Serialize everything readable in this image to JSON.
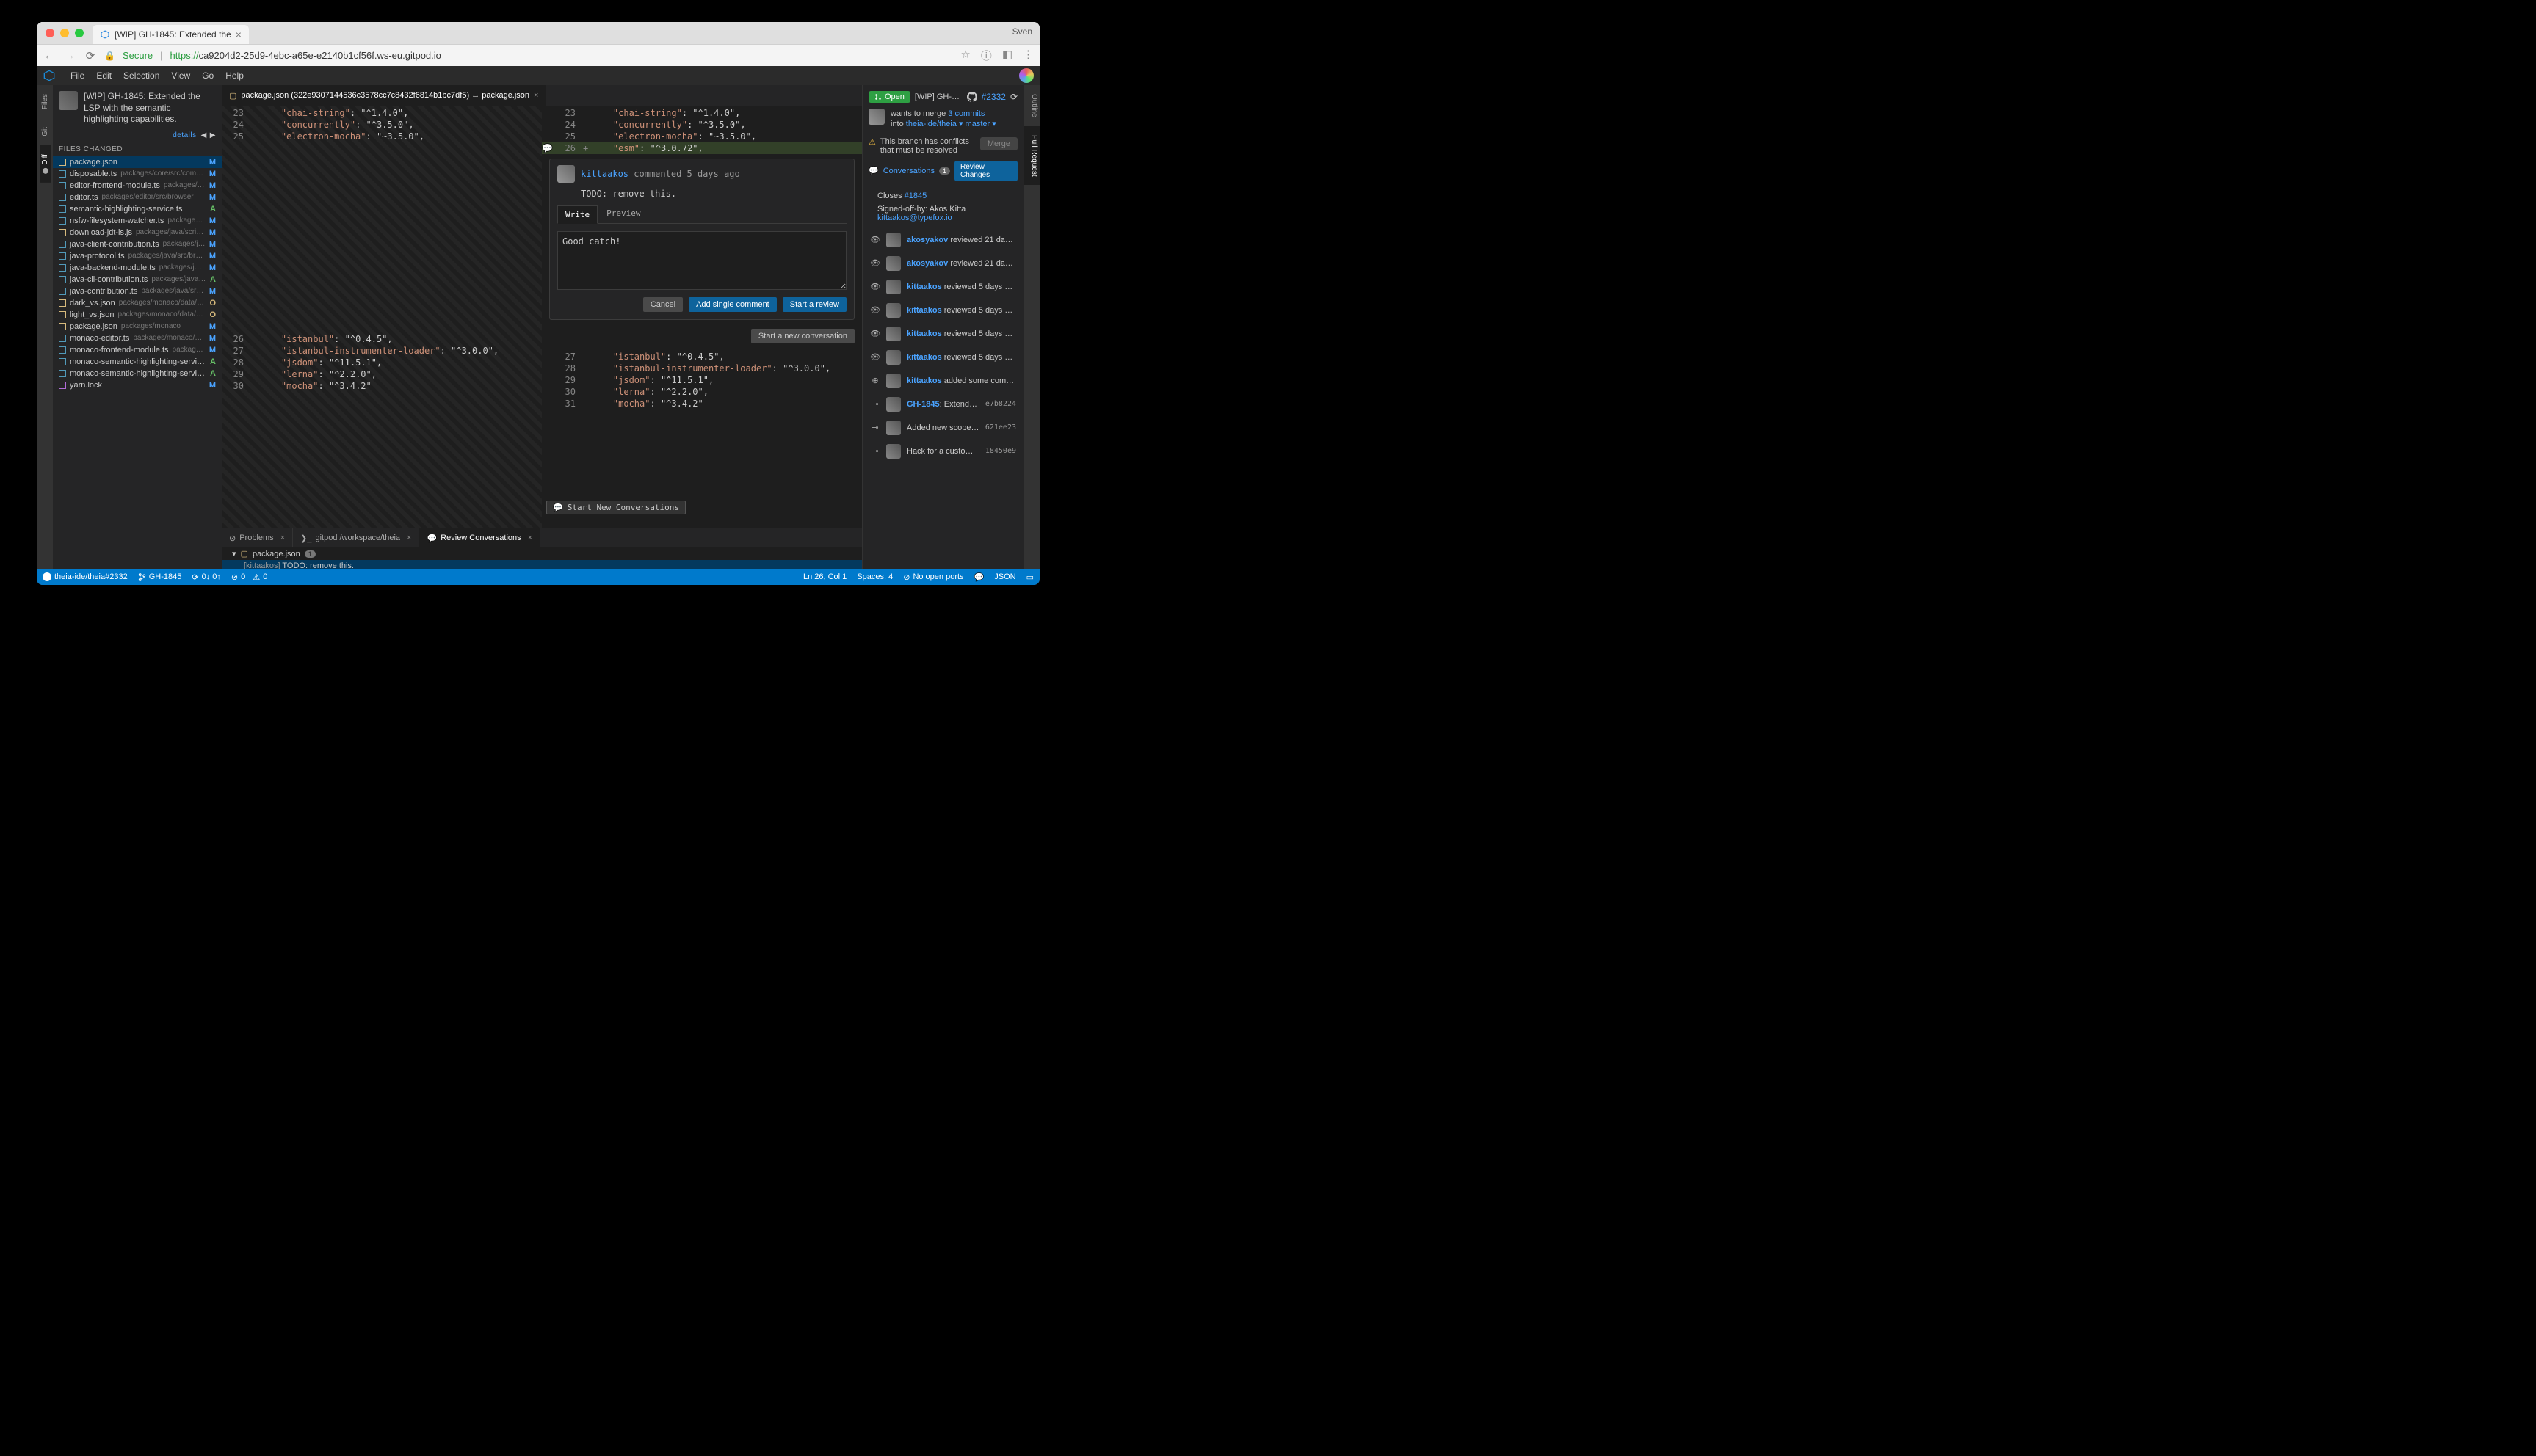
{
  "browser": {
    "profile_name": "Sven",
    "tab_title": "[WIP] GH-1845: Extended the",
    "secure_label": "Secure",
    "url_prefix": "https://",
    "url_host": "ca9204d2-25d9-4ebc-a65e-e2140b1cf56f.ws-eu.gitpod.io"
  },
  "menubar": [
    "File",
    "Edit",
    "Selection",
    "View",
    "Go",
    "Help"
  ],
  "activity_left": [
    {
      "label": "Files",
      "dot": false
    },
    {
      "label": "Git",
      "dot": false
    },
    {
      "label": "Diff",
      "dot": true
    }
  ],
  "activity_right": [
    {
      "label": "Outline"
    },
    {
      "label": "Pull Request"
    }
  ],
  "side_panel": {
    "pr_title": "[WIP] GH-1845: Extended the LSP with the semantic highlighting capabilities.",
    "details": "details",
    "header": "FILES CHANGED",
    "files": [
      {
        "icon": "yellow",
        "name": "package.json",
        "path": "",
        "status": "M",
        "sel": true
      },
      {
        "icon": "blue",
        "name": "disposable.ts",
        "path": "packages/core/src/common",
        "status": "M"
      },
      {
        "icon": "blue",
        "name": "editor-frontend-module.ts",
        "path": "packages/e…",
        "status": "M"
      },
      {
        "icon": "blue",
        "name": "editor.ts",
        "path": "packages/editor/src/browser",
        "status": "M"
      },
      {
        "icon": "blue",
        "name": "semantic-highlighting-service.ts",
        "path": "",
        "status": "A"
      },
      {
        "icon": "blue",
        "name": "nsfw-filesystem-watcher.ts",
        "path": "packages…",
        "status": "M"
      },
      {
        "icon": "yellow",
        "name": "download-jdt-ls.js",
        "path": "packages/java/scripts",
        "status": "M"
      },
      {
        "icon": "blue",
        "name": "java-client-contribution.ts",
        "path": "packages/j…",
        "status": "M"
      },
      {
        "icon": "blue",
        "name": "java-protocol.ts",
        "path": "packages/java/src/bro…",
        "status": "M"
      },
      {
        "icon": "blue",
        "name": "java-backend-module.ts",
        "path": "packages/j…",
        "status": "M"
      },
      {
        "icon": "blue",
        "name": "java-cli-contribution.ts",
        "path": "packages/java/…",
        "status": "A"
      },
      {
        "icon": "blue",
        "name": "java-contribution.ts",
        "path": "packages/java/src/…",
        "status": "M"
      },
      {
        "icon": "yellow",
        "name": "dark_vs.json",
        "path": "packages/monaco/data/m…",
        "status": "O"
      },
      {
        "icon": "yellow",
        "name": "light_vs.json",
        "path": "packages/monaco/data/m…",
        "status": "O"
      },
      {
        "icon": "yellow",
        "name": "package.json",
        "path": "packages/monaco",
        "status": "M"
      },
      {
        "icon": "blue",
        "name": "monaco-editor.ts",
        "path": "packages/monaco/sr…",
        "status": "M"
      },
      {
        "icon": "blue",
        "name": "monaco-frontend-module.ts",
        "path": "package…",
        "status": "M"
      },
      {
        "icon": "blue",
        "name": "monaco-semantic-highlighting-servi…",
        "path": "",
        "status": "A"
      },
      {
        "icon": "blue",
        "name": "monaco-semantic-highlighting-servi…",
        "path": "",
        "status": "A"
      },
      {
        "icon": "purple",
        "name": "yarn.lock",
        "path": "",
        "status": "M"
      }
    ]
  },
  "editor": {
    "tab_label": "package.json (322e9307144536c3578cc7c8432f6814b1bc7df5) ↔ package.json",
    "hover_label": "Start New Conversations",
    "left_lines": [
      {
        "ln": "23",
        "t": "    \"chai-string\": \"^1.4.0\","
      },
      {
        "ln": "24",
        "t": "    \"concurrently\": \"^3.5.0\","
      },
      {
        "ln": "25",
        "t": "    \"electron-mocha\": \"~3.5.0\","
      },
      {
        "ln": "",
        "t": ""
      },
      {
        "ln": "26",
        "t": "    \"istanbul\": \"^0.4.5\","
      },
      {
        "ln": "27",
        "t": "    \"istanbul-instrumenter-loader\": \"^3.0.0\","
      },
      {
        "ln": "28",
        "t": "    \"jsdom\": \"^11.5.1\","
      },
      {
        "ln": "29",
        "t": "    \"lerna\": \"^2.2.0\","
      },
      {
        "ln": "30",
        "t": "    \"mocha\": \"^3.4.2\""
      }
    ],
    "right_lines_top": [
      {
        "ln": "23",
        "t": "    \"chai-string\": \"^1.4.0\","
      },
      {
        "ln": "24",
        "t": "    \"concurrently\": \"^3.5.0\","
      },
      {
        "ln": "25",
        "t": "    \"electron-mocha\": \"~3.5.0\","
      },
      {
        "ln": "26",
        "plus": "+",
        "added": true,
        "t": "    \"esm\": \"^3.0.72\","
      }
    ],
    "right_lines_bottom": [
      {
        "ln": "27",
        "t": "    \"istanbul\": \"^0.4.5\","
      },
      {
        "ln": "28",
        "t": "    \"istanbul-instrumenter-loader\": \"^3.0.0\","
      },
      {
        "ln": "29",
        "t": "    \"jsdom\": \"^11.5.1\","
      },
      {
        "ln": "30",
        "t": "    \"lerna\": \"^2.2.0\","
      },
      {
        "ln": "31",
        "t": "    \"mocha\": \"^3.4.2\""
      }
    ]
  },
  "comment": {
    "author": "kittaakos",
    "when": "commented 5 days ago",
    "body": "TODO: remove this.",
    "tab_write": "Write",
    "tab_preview": "Preview",
    "input_value": "Good catch!",
    "btn_cancel": "Cancel",
    "btn_single": "Add single comment",
    "btn_review": "Start a review",
    "btn_newconv": "Start a new conversation"
  },
  "bottom": {
    "tabs": {
      "problems": "Problems",
      "terminal": "gitpod /workspace/theia",
      "review": "Review Conversations"
    },
    "file": "package.json",
    "badge": "1",
    "item_author": "[kittaakos]",
    "item_text": "TODO: remove this."
  },
  "pr_panel": {
    "open": "Open",
    "title": "[WIP] GH-…",
    "number": "#2332",
    "wants": "wants to merge ",
    "commits": "3 commits",
    "into": "into ",
    "into_target": "theia-ide/theia ▾ master ▾",
    "conflict": "This branch has conflicts that must be resolved",
    "merge_btn": "Merge",
    "conversations": "Conversations",
    "conv_badge": "1",
    "review_changes": "Review Changes",
    "closes": "Closes ",
    "closes_issue": "#1845",
    "sign1": "Signed-off-by: Akos Kitta",
    "sign2": "kittaakos@typefox.io",
    "timeline": [
      {
        "ico": "eye",
        "actor": "akosyakov",
        "text": " reviewed 21 da…"
      },
      {
        "ico": "eye",
        "actor": "akosyakov",
        "text": " reviewed 21 da…"
      },
      {
        "ico": "eye",
        "actor": "kittaakos",
        "text": " reviewed 5 days …"
      },
      {
        "ico": "eye",
        "actor": "kittaakos",
        "text": " reviewed 5 days …"
      },
      {
        "ico": "eye",
        "actor": "kittaakos",
        "text": " reviewed 5 days …"
      },
      {
        "ico": "eye",
        "actor": "kittaakos",
        "text": " reviewed 5 days …"
      },
      {
        "ico": "plus",
        "actor": "kittaakos",
        "text": " added some commits …"
      },
      {
        "ico": "commit",
        "actor": "GH-1845",
        "text": ": Extende…",
        "hash": "e7b8224",
        "link": true
      },
      {
        "ico": "commit",
        "plain": "Added new scope…",
        "hash": "621ee23"
      },
      {
        "ico": "commit",
        "plain": "Hack for a custom…",
        "hash": "18450e9"
      }
    ]
  },
  "statusbar": {
    "repo": "theia-ide/theia#2332",
    "branch": "GH-1845",
    "sync": "0↓ 0↑",
    "errors": "0",
    "warnings": "0",
    "lncol": "Ln 26, Col 1",
    "spaces": "Spaces: 4",
    "ports": "No open ports",
    "lang": "JSON"
  }
}
